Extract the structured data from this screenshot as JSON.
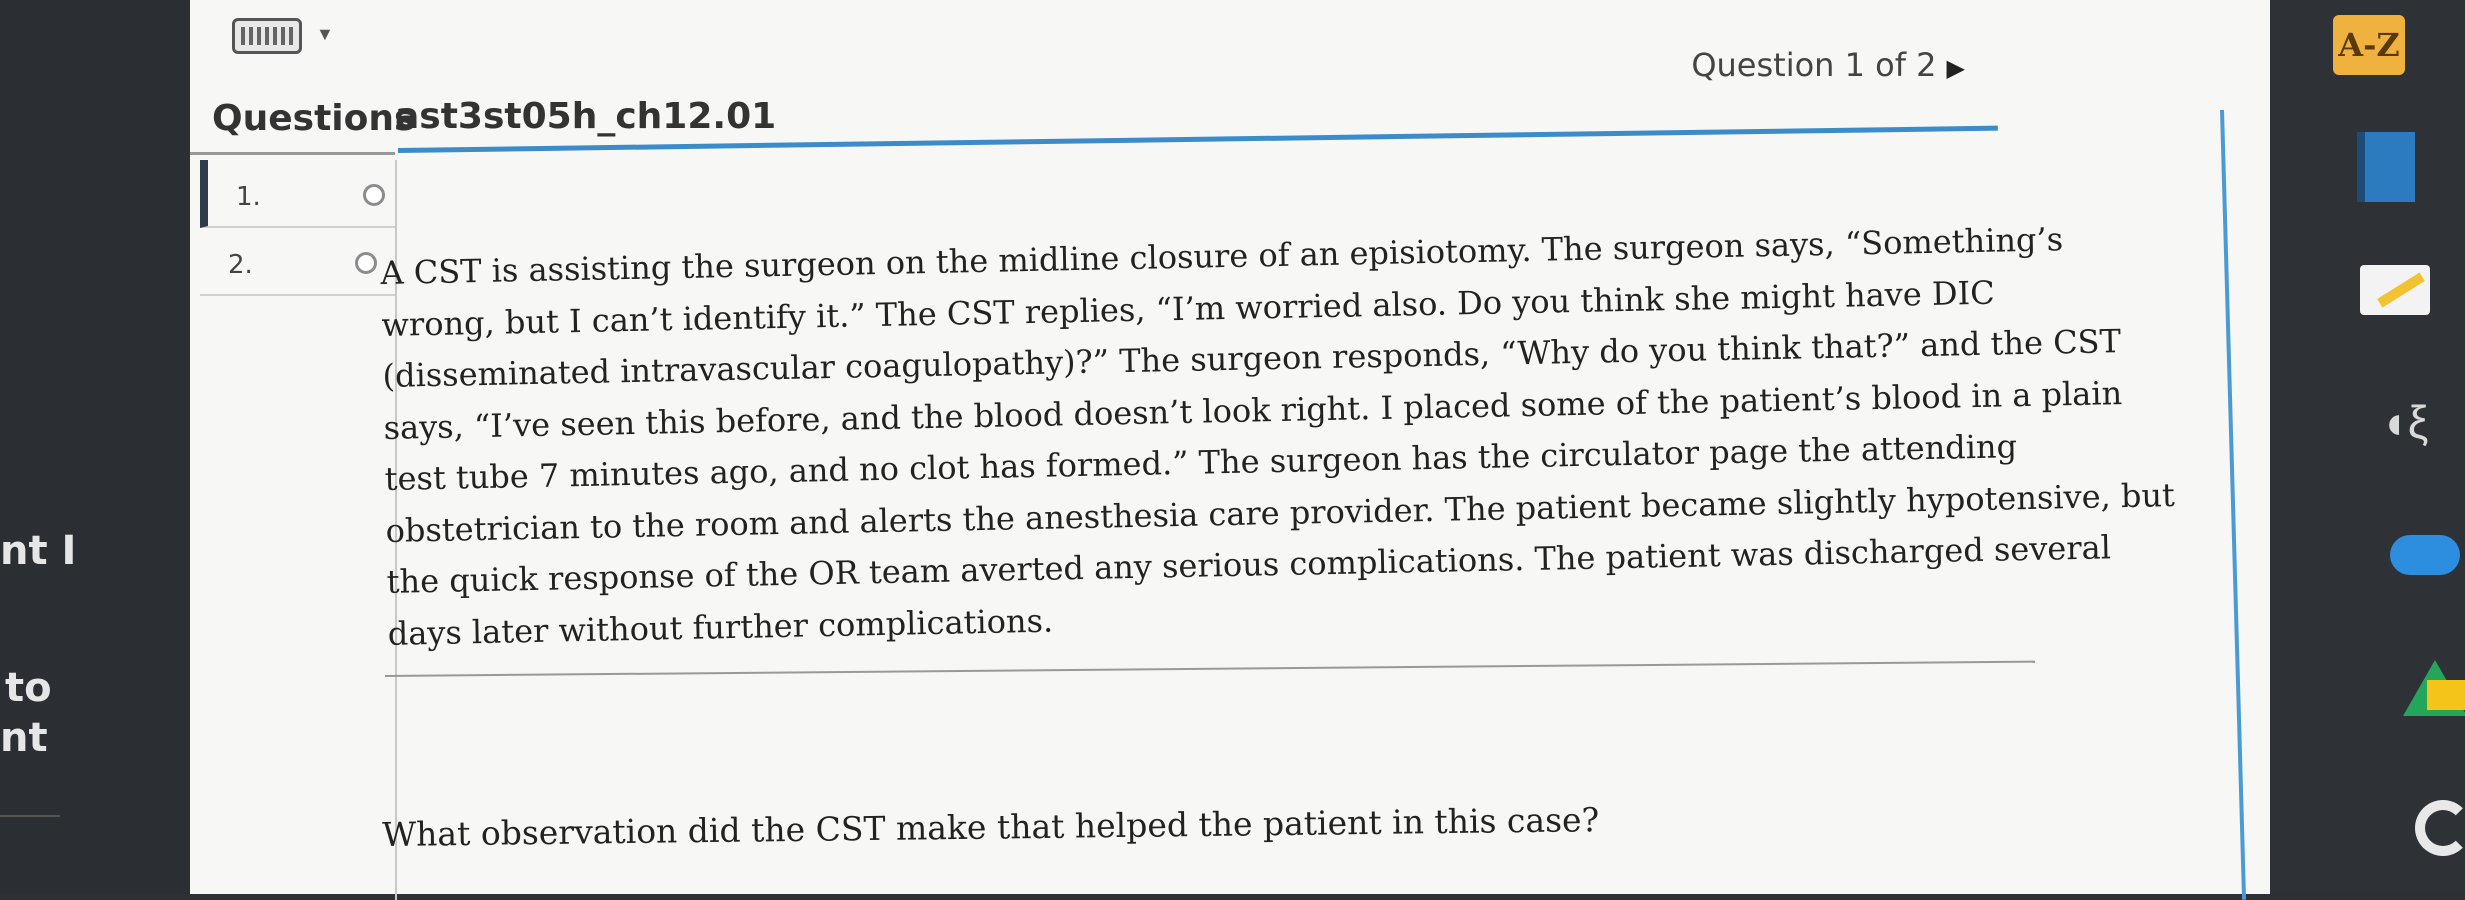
{
  "header": {
    "question_counter": "Question 1 of 2",
    "tab_questions": "Questions",
    "assignment_title": "ast3st05h_ch12.01"
  },
  "sidebar": {
    "items": [
      {
        "number": "1.",
        "state": "unanswered"
      },
      {
        "number": "2.",
        "state": "unanswered"
      }
    ]
  },
  "question": {
    "passage": "A CST is assisting the surgeon on the midline closure of an episiotomy. The surgeon says, “Something’s wrong, but I can’t identify it.” The CST replies, “I’m worried also. Do you think she might have DIC (disseminated intravascular coagulopathy)?” The surgeon responds, “Why do you think that?” and the CST says, “I’ve seen this before, and the blood doesn’t look right. I placed some of the patient’s blood in a plain test tube 7 minutes ago, and no clot has formed.” The surgeon has the circulator page the attending obstetrician to the room and alerts the anesthesia care provider. The patient became slightly hypotensive, but the quick response of the OR team averted any serious complications. The patient was discharged several days later without further complications.",
    "prompt": "What observation did the CST make that helped the patient in this case?"
  },
  "left_background_text": [
    "nt I",
    "to",
    "nt"
  ],
  "dock": {
    "az_label": "A-Z",
    "icons": [
      "book-icon",
      "pencil-icon",
      "text-to-speech-icon",
      "cloud-icon",
      "drive-icon",
      "chrome-icon"
    ]
  },
  "colors": {
    "accent_blue": "#3c8ccb",
    "az_background": "#f0b23e"
  }
}
